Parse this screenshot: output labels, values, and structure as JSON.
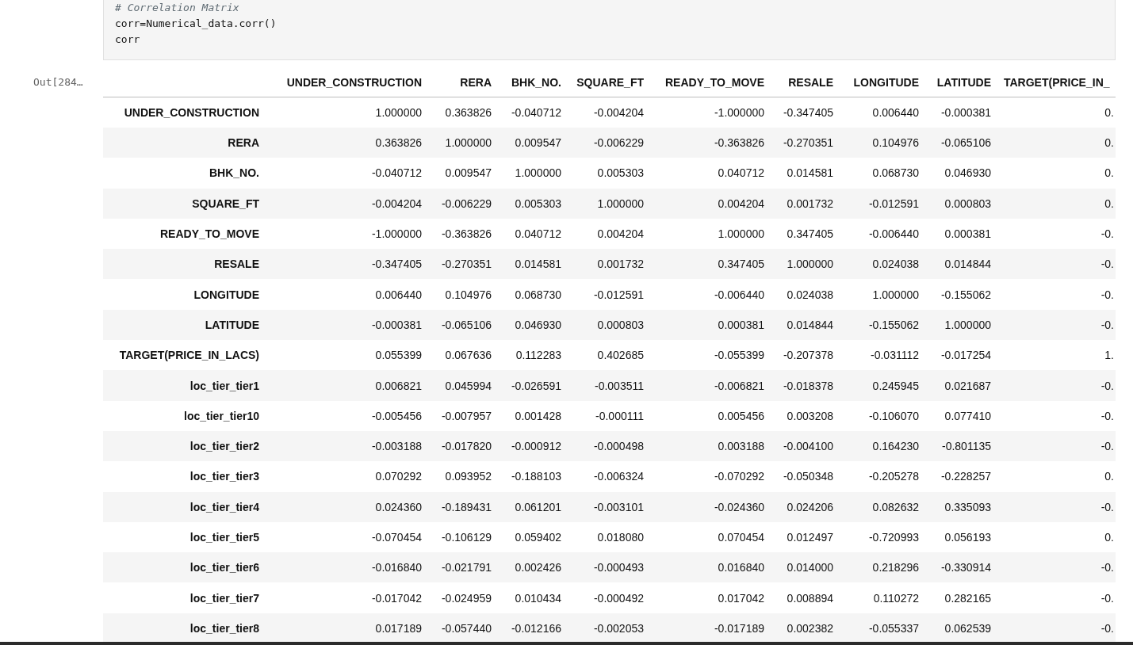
{
  "code_cell": {
    "lines": [
      {
        "kind": "comment",
        "text": "# Correlation Matrix"
      },
      {
        "kind": "code",
        "text": "corr=Numerical_data.corr()"
      },
      {
        "kind": "code",
        "text": "corr"
      }
    ]
  },
  "output_cell": {
    "prompt": "Out[284…",
    "table": {
      "columns": [
        "UNDER_CONSTRUCTION",
        "RERA",
        "BHK_NO.",
        "SQUARE_FT",
        "READY_TO_MOVE",
        "RESALE",
        "LONGITUDE",
        "LATITUDE",
        "TARGET(PRICE_IN_"
      ],
      "rows": [
        {
          "label": "UNDER_CONSTRUCTION",
          "values": [
            "1.000000",
            "0.363826",
            "-0.040712",
            "-0.004204",
            "-1.000000",
            "-0.347405",
            "0.006440",
            "-0.000381",
            "0."
          ]
        },
        {
          "label": "RERA",
          "values": [
            "0.363826",
            "1.000000",
            "0.009547",
            "-0.006229",
            "-0.363826",
            "-0.270351",
            "0.104976",
            "-0.065106",
            "0."
          ]
        },
        {
          "label": "BHK_NO.",
          "values": [
            "-0.040712",
            "0.009547",
            "1.000000",
            "0.005303",
            "0.040712",
            "0.014581",
            "0.068730",
            "0.046930",
            "0."
          ]
        },
        {
          "label": "SQUARE_FT",
          "values": [
            "-0.004204",
            "-0.006229",
            "0.005303",
            "1.000000",
            "0.004204",
            "0.001732",
            "-0.012591",
            "0.000803",
            "0."
          ]
        },
        {
          "label": "READY_TO_MOVE",
          "values": [
            "-1.000000",
            "-0.363826",
            "0.040712",
            "0.004204",
            "1.000000",
            "0.347405",
            "-0.006440",
            "0.000381",
            "-0."
          ]
        },
        {
          "label": "RESALE",
          "values": [
            "-0.347405",
            "-0.270351",
            "0.014581",
            "0.001732",
            "0.347405",
            "1.000000",
            "0.024038",
            "0.014844",
            "-0."
          ]
        },
        {
          "label": "LONGITUDE",
          "values": [
            "0.006440",
            "0.104976",
            "0.068730",
            "-0.012591",
            "-0.006440",
            "0.024038",
            "1.000000",
            "-0.155062",
            "-0."
          ]
        },
        {
          "label": "LATITUDE",
          "values": [
            "-0.000381",
            "-0.065106",
            "0.046930",
            "0.000803",
            "0.000381",
            "0.014844",
            "-0.155062",
            "1.000000",
            "-0."
          ]
        },
        {
          "label": "TARGET(PRICE_IN_LACS)",
          "values": [
            "0.055399",
            "0.067636",
            "0.112283",
            "0.402685",
            "-0.055399",
            "-0.207378",
            "-0.031112",
            "-0.017254",
            "1."
          ]
        },
        {
          "label": "loc_tier_tier1",
          "values": [
            "0.006821",
            "0.045994",
            "-0.026591",
            "-0.003511",
            "-0.006821",
            "-0.018378",
            "0.245945",
            "0.021687",
            "-0."
          ]
        },
        {
          "label": "loc_tier_tier10",
          "values": [
            "-0.005456",
            "-0.007957",
            "0.001428",
            "-0.000111",
            "0.005456",
            "0.003208",
            "-0.106070",
            "0.077410",
            "-0."
          ]
        },
        {
          "label": "loc_tier_tier2",
          "values": [
            "-0.003188",
            "-0.017820",
            "-0.000912",
            "-0.000498",
            "0.003188",
            "-0.004100",
            "0.164230",
            "-0.801135",
            "-0."
          ]
        },
        {
          "label": "loc_tier_tier3",
          "values": [
            "0.070292",
            "0.093952",
            "-0.188103",
            "-0.006324",
            "-0.070292",
            "-0.050348",
            "-0.205278",
            "-0.228257",
            "0."
          ]
        },
        {
          "label": "loc_tier_tier4",
          "values": [
            "0.024360",
            "-0.189431",
            "0.061201",
            "-0.003101",
            "-0.024360",
            "0.024206",
            "0.082632",
            "0.335093",
            "-0."
          ]
        },
        {
          "label": "loc_tier_tier5",
          "values": [
            "-0.070454",
            "-0.106129",
            "0.059402",
            "0.018080",
            "0.070454",
            "0.012497",
            "-0.720993",
            "0.056193",
            "0."
          ]
        },
        {
          "label": "loc_tier_tier6",
          "values": [
            "-0.016840",
            "-0.021791",
            "0.002426",
            "-0.000493",
            "0.016840",
            "0.014000",
            "0.218296",
            "-0.330914",
            "-0."
          ]
        },
        {
          "label": "loc_tier_tier7",
          "values": [
            "-0.017042",
            "-0.024959",
            "0.010434",
            "-0.000492",
            "0.017042",
            "0.008894",
            "0.110272",
            "0.282165",
            "-0."
          ]
        },
        {
          "label": "loc_tier_tier8",
          "values": [
            "0.017189",
            "-0.057440",
            "-0.012166",
            "-0.002053",
            "-0.017189",
            "0.002382",
            "-0.055337",
            "0.062539",
            "-0."
          ]
        }
      ]
    }
  }
}
